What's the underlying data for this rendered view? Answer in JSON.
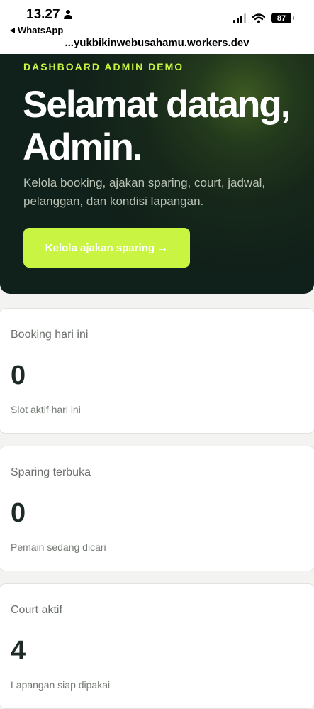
{
  "status_bar": {
    "time": "13.27",
    "back_app": "WhatsApp",
    "battery": "87",
    "url": "...yukbikinwebusahamu.workers.dev"
  },
  "hero": {
    "eyebrow": "DASHBOARD ADMIN DEMO",
    "title": "Selamat datang, Admin.",
    "description": "Kelola booking, ajakan sparing, court, jadwal, pelanggan, dan kondisi lapangan.",
    "cta_label": "Kelola ajakan sparing →"
  },
  "stats": [
    {
      "label": "Booking hari ini",
      "value": "0",
      "sub": "Slot aktif hari ini"
    },
    {
      "label": "Sparing terbuka",
      "value": "0",
      "sub": "Pemain sedang dicari"
    },
    {
      "label": "Court aktif",
      "value": "4",
      "sub": "Lapangan siap dipakai"
    }
  ],
  "colors": {
    "accent": "#c9f542",
    "hero_bg": "#10201a",
    "page_bg": "#f3f4f1"
  }
}
